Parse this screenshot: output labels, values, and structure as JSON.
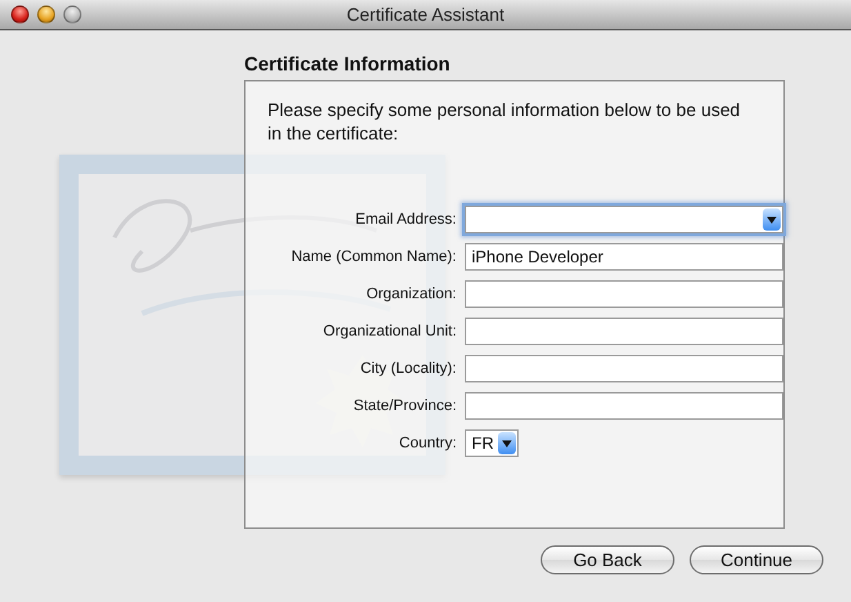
{
  "window": {
    "title": "Certificate Assistant"
  },
  "heading": "Certificate Information",
  "intro": "Please specify some personal information below to be used in the certificate:",
  "fields": [
    {
      "label": "Email Address:",
      "kind": "combo",
      "focused": true
    },
    {
      "label": "Name (Common Name):",
      "kind": "text",
      "value": "iPhone Developer",
      "focused": false
    },
    {
      "label": "Organization:",
      "kind": "text",
      "focused": false
    },
    {
      "label": "Organizational Unit:",
      "kind": "text",
      "focused": false
    },
    {
      "label": "City (Locality):",
      "kind": "text",
      "focused": false
    },
    {
      "label": "State/Province:",
      "kind": "text",
      "focused": false
    },
    {
      "label": "Country:",
      "kind": "popup",
      "value": "FR",
      "focused": false
    }
  ],
  "buttons": [
    "Go Back",
    "Continue"
  ]
}
